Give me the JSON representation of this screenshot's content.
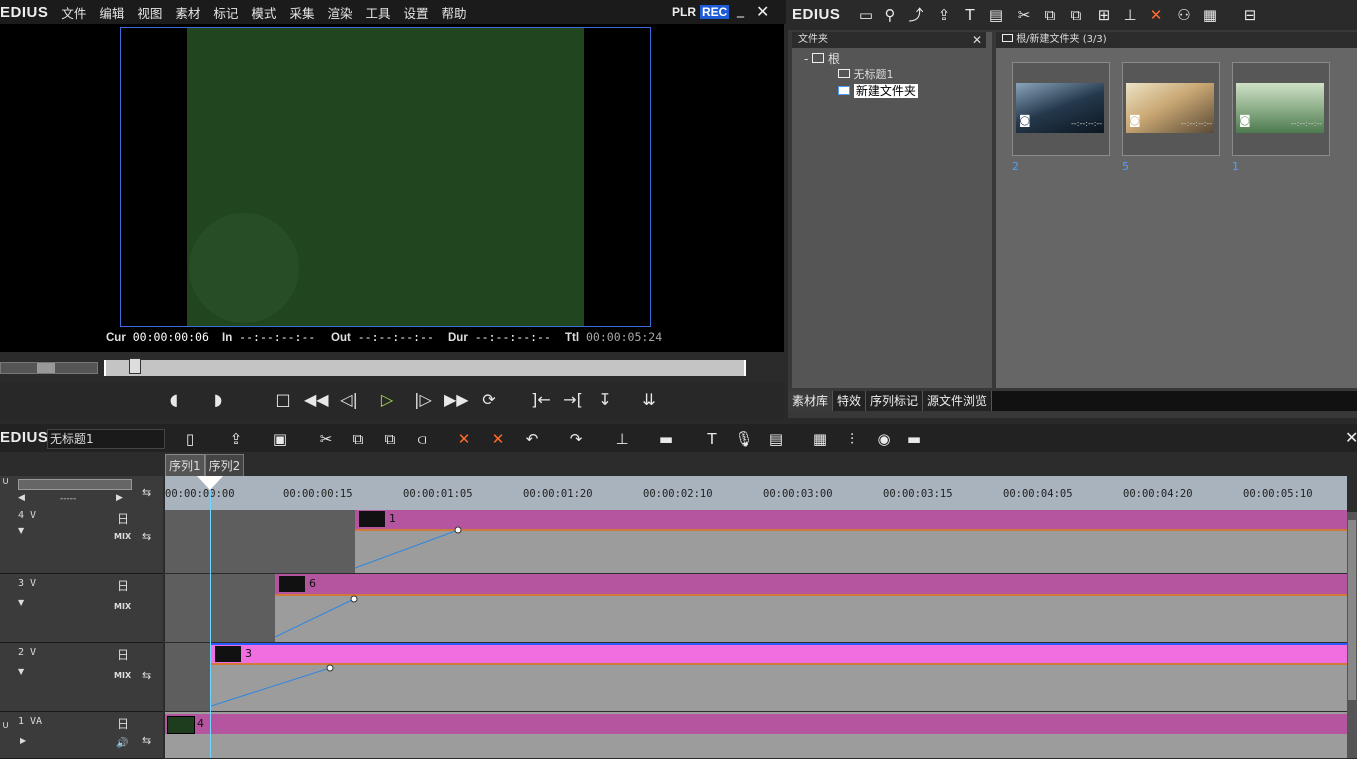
{
  "app": {
    "logo": "EDIUS"
  },
  "menu": [
    "文件",
    "编辑",
    "视图",
    "素材",
    "标记",
    "模式",
    "采集",
    "渲染",
    "工具",
    "设置",
    "帮助"
  ],
  "player": {
    "plr": "PLR",
    "rec": "REC",
    "cur_label": "Cur",
    "cur": "00:00:00:06",
    "in_label": "In",
    "in": "--:--:--:--",
    "out_label": "Out",
    "out": "--:--:--:--",
    "dur_label": "Dur",
    "dur": "--:--:--:--",
    "ttl_label": "Ttl",
    "ttl": "00:00:05:24"
  },
  "bin": {
    "logo": "EDIUS",
    "folder_header": "文件夹",
    "folders": {
      "root": "根",
      "child1": "无标题1",
      "child2": "新建文件夹"
    },
    "path": "根/新建文件夹 (3/3)",
    "thumbs": [
      {
        "num": "2",
        "tc": "--:--:--:--"
      },
      {
        "num": "5",
        "tc": "--:--:--:--"
      },
      {
        "num": "1",
        "tc": "--:--:--:--"
      }
    ],
    "tabs": [
      "素材库",
      "特效",
      "序列标记",
      "源文件浏览"
    ]
  },
  "timeline": {
    "logo": "EDIUS",
    "project": "无标题1",
    "seq_tabs": [
      "序列1",
      "序列2"
    ],
    "range": "-----",
    "ruler": [
      "00:00:00:00",
      "00:00:00:15",
      "00:00:01:05",
      "00:00:01:20",
      "00:00:02:10",
      "00:00:03:00",
      "00:00:03:15",
      "00:00:04:05",
      "00:00:04:20",
      "00:00:05:10"
    ],
    "tracks": [
      {
        "label": "4 V",
        "mix": "MIX",
        "clip": "1"
      },
      {
        "label": "3 V",
        "mix": "MIX",
        "clip": "6"
      },
      {
        "label": "2 V",
        "mix": "MIX",
        "clip": "3"
      },
      {
        "label": "1 VA",
        "clip": "4"
      }
    ]
  },
  "colors": {
    "accent": "#3d6cd8",
    "clip": "#b5559f",
    "clip_selected": "#f06ee0",
    "rec": "#1e5bd8"
  }
}
